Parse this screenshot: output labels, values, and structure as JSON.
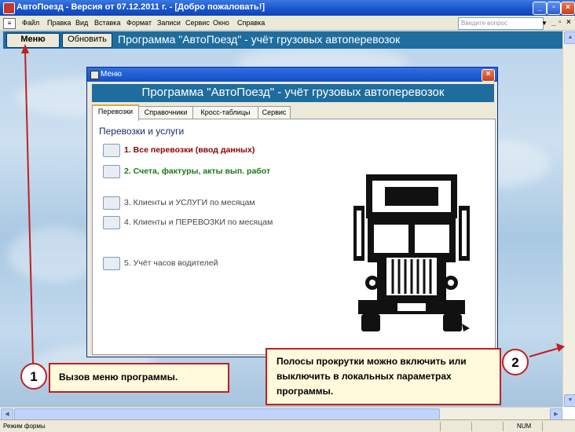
{
  "app": {
    "title": "АвтоПоезд - Версия от 07.12.2011 г. - [Добро пожаловать!]",
    "window_controls": [
      "_",
      "▫",
      "×"
    ]
  },
  "menubar": {
    "items": [
      "Файл",
      "Правка",
      "Вид",
      "Вставка",
      "Формат",
      "Записи",
      "Сервис",
      "Окно",
      "Справка"
    ],
    "help_placeholder": "Введите вопрос",
    "mdi_controls": [
      "_",
      "▫",
      "×"
    ]
  },
  "header": {
    "menu_button": "Меню",
    "refresh_button": "Обновить",
    "title": "Программа \"АвтоПоезд\" - учёт грузовых автоперевозок"
  },
  "dialog": {
    "title": "Меню",
    "close": "×",
    "banner": "Программа \"АвтоПоезд\" - учёт грузовых автоперевозок",
    "tabs": [
      "Перевозки",
      "Справочники",
      "Кросс-таблицы",
      "Сервис"
    ],
    "active_tab": "Перевозки",
    "section_title": "Перевозки и услуги",
    "options": [
      {
        "label": "1. Все перевозки (ввод данных)",
        "color": "#8b0000"
      },
      {
        "label": "2. Счета, фактуры, акты вып. работ",
        "color": "#1a7a1a"
      },
      {
        "label": "3. Клиенты и УСЛУГИ по месяцам",
        "color": "#444444"
      },
      {
        "label": "4. Клиенты и ПЕРЕВОЗКИ по месяцам",
        "color": "#444444"
      },
      {
        "label": "5. Учёт часов водителей",
        "color": "#444444"
      }
    ],
    "truck_icon": "truck-icon"
  },
  "callouts": {
    "one": {
      "number": "1",
      "text": "Вызов меню программы."
    },
    "two": {
      "number": "2",
      "text": "Полосы прокрутки можно включить или выключить в локальных параметрах программы."
    }
  },
  "status": {
    "left": "Режим формы",
    "right": "NUM"
  },
  "colors": {
    "accent": "#1f6d9e",
    "callout_border": "#c02020",
    "callout_fill": "#fffadb"
  }
}
